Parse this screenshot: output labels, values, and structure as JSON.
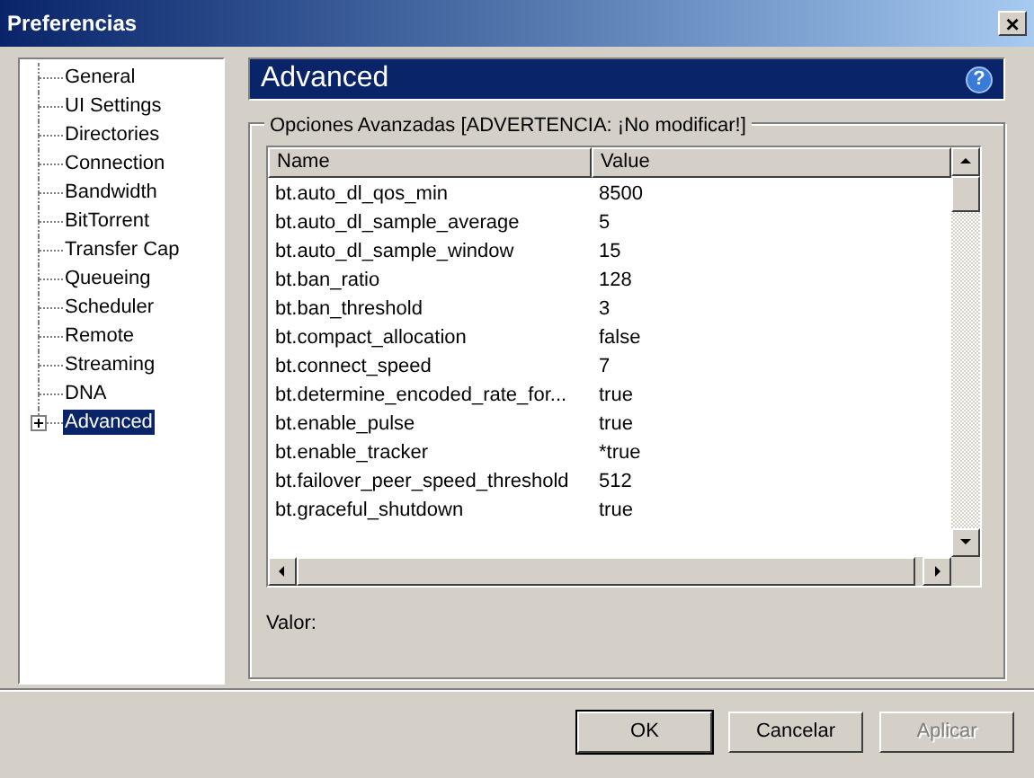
{
  "window": {
    "title": "Preferencias",
    "close": "×"
  },
  "sidebar": {
    "items": [
      {
        "label": "General",
        "selected": false
      },
      {
        "label": "UI Settings",
        "selected": false
      },
      {
        "label": "Directories",
        "selected": false
      },
      {
        "label": "Connection",
        "selected": false
      },
      {
        "label": "Bandwidth",
        "selected": false
      },
      {
        "label": "BitTorrent",
        "selected": false
      },
      {
        "label": "Transfer Cap",
        "selected": false
      },
      {
        "label": "Queueing",
        "selected": false
      },
      {
        "label": "Scheduler",
        "selected": false
      },
      {
        "label": "Remote",
        "selected": false
      },
      {
        "label": "Streaming",
        "selected": false
      },
      {
        "label": "DNA",
        "selected": false
      },
      {
        "label": "Advanced",
        "selected": true,
        "expanded": false
      }
    ]
  },
  "header": {
    "title": "Advanced",
    "help": "?"
  },
  "group": {
    "title": "Opciones Avanzadas [ADVERTENCIA: ¡No modificar!]",
    "table": {
      "columns": [
        "Name",
        "Value"
      ],
      "rows": [
        [
          "bt.auto_dl_qos_min",
          "8500"
        ],
        [
          "bt.auto_dl_sample_average",
          "5"
        ],
        [
          "bt.auto_dl_sample_window",
          "15"
        ],
        [
          "bt.ban_ratio",
          "128"
        ],
        [
          "bt.ban_threshold",
          "3"
        ],
        [
          "bt.compact_allocation",
          "false"
        ],
        [
          "bt.connect_speed",
          "7"
        ],
        [
          "bt.determine_encoded_rate_for...",
          "true"
        ],
        [
          "bt.enable_pulse",
          "true"
        ],
        [
          "bt.enable_tracker",
          "*true"
        ],
        [
          "bt.failover_peer_speed_threshold",
          "512"
        ],
        [
          "bt.graceful_shutdown",
          "true"
        ]
      ]
    },
    "value_label": "Valor:"
  },
  "buttons": [
    {
      "label": "OK",
      "disabled": false,
      "default": true
    },
    {
      "label": "Cancelar",
      "disabled": false,
      "default": false
    },
    {
      "label": "Aplicar",
      "disabled": true,
      "default": false
    }
  ]
}
